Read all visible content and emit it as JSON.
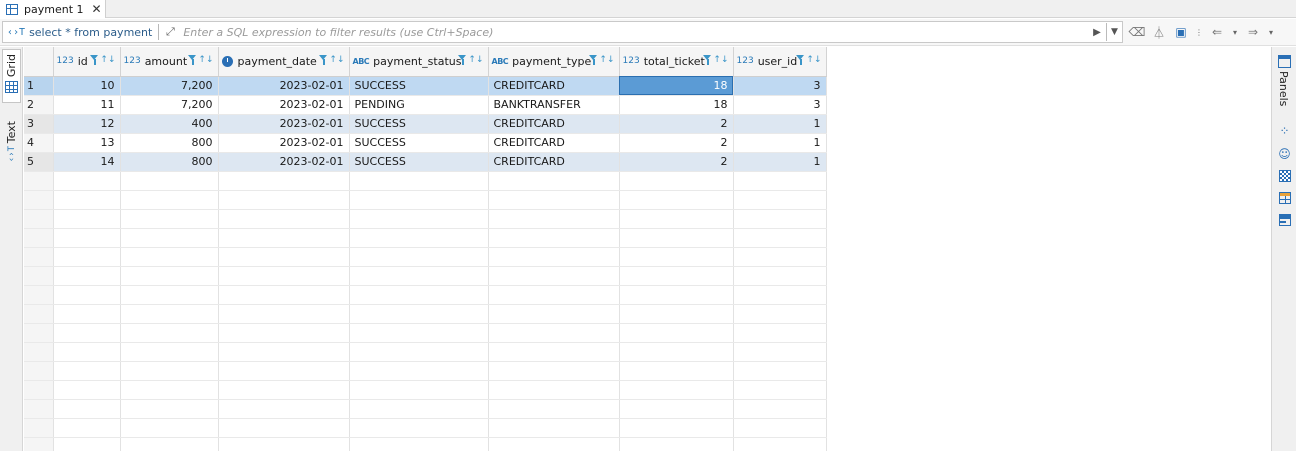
{
  "tab": {
    "label": "payment 1",
    "close": "✕"
  },
  "filter": {
    "query": "select * from payment",
    "placeholder": "Enter a SQL expression to filter results (use Ctrl+Space)"
  },
  "left_tabs": {
    "grid": "Grid",
    "text": "Text"
  },
  "right_panel": {
    "label": "Panels"
  },
  "columns": [
    {
      "name": "id",
      "type": "123"
    },
    {
      "name": "amount",
      "type": "123"
    },
    {
      "name": "payment_date",
      "type": "date"
    },
    {
      "name": "payment_status",
      "type": "ABC"
    },
    {
      "name": "payment_type",
      "type": "ABC"
    },
    {
      "name": "total_ticket",
      "type": "123"
    },
    {
      "name": "user_id",
      "type": "123"
    }
  ],
  "rows": [
    {
      "n": "1",
      "id": "10",
      "amount": "7,200",
      "payment_date": "2023-02-01",
      "payment_status": "SUCCESS",
      "payment_type": "CREDITCARD",
      "total_ticket": "18",
      "user_id": "3"
    },
    {
      "n": "2",
      "id": "11",
      "amount": "7,200",
      "payment_date": "2023-02-01",
      "payment_status": "PENDING",
      "payment_type": "BANKTRANSFER",
      "total_ticket": "18",
      "user_id": "3"
    },
    {
      "n": "3",
      "id": "12",
      "amount": "400",
      "payment_date": "2023-02-01",
      "payment_status": "SUCCESS",
      "payment_type": "CREDITCARD",
      "total_ticket": "2",
      "user_id": "1"
    },
    {
      "n": "4",
      "id": "13",
      "amount": "800",
      "payment_date": "2023-02-01",
      "payment_status": "SUCCESS",
      "payment_type": "CREDITCARD",
      "total_ticket": "2",
      "user_id": "1"
    },
    {
      "n": "5",
      "id": "14",
      "amount": "800",
      "payment_date": "2023-02-01",
      "payment_status": "SUCCESS",
      "payment_type": "CREDITCARD",
      "total_ticket": "2",
      "user_id": "1"
    }
  ],
  "colors": {
    "accent": "#2a6fb5",
    "selected_row": "#bfd9f2",
    "alt_row": "#dde7f2",
    "active_cell": "#5b9bd5"
  }
}
